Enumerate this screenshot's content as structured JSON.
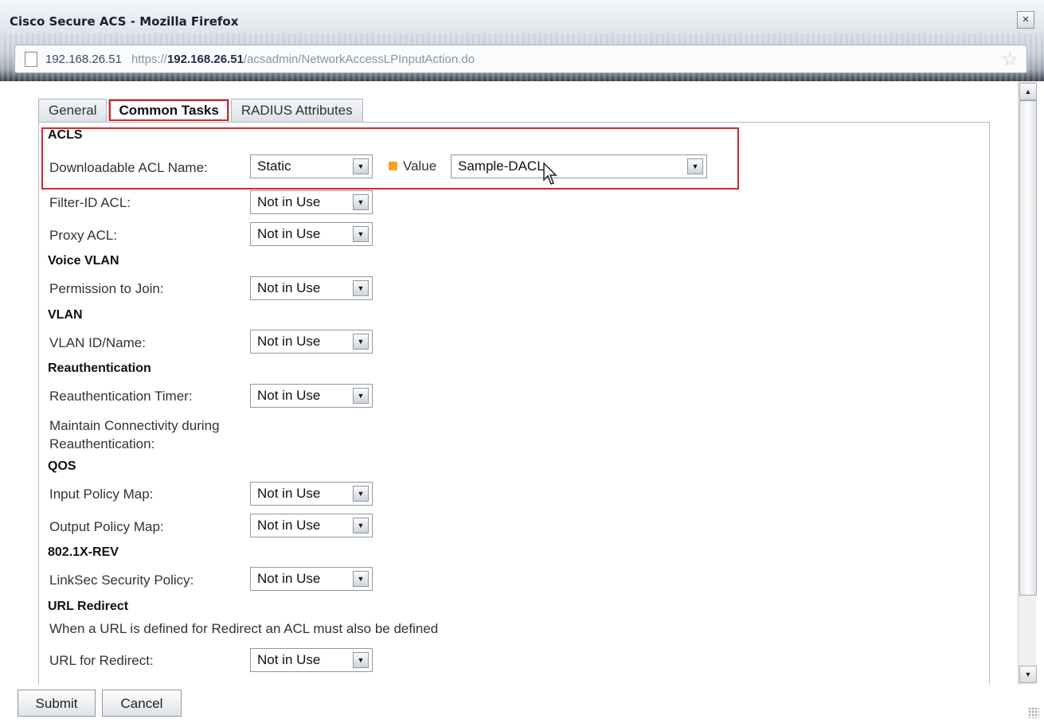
{
  "window": {
    "title": "Cisco Secure ACS - Mozilla Firefox",
    "close_label": "×"
  },
  "address": {
    "host": "192.168.26.51",
    "url_prefix": "https://",
    "url_host": "192.168.26.51",
    "url_path": "/acsadmin/NetworkAccessLPInputAction.do"
  },
  "tabs": [
    {
      "label": "General",
      "active": false
    },
    {
      "label": "Common Tasks",
      "active": true
    },
    {
      "label": "RADIUS Attributes",
      "active": false
    }
  ],
  "sections": {
    "acls": "ACLS",
    "voice_vlan": "Voice VLAN",
    "vlan": "VLAN",
    "reauth": "Reauthentication",
    "qos": "QOS",
    "dot1x": "802.1X-REV",
    "url_redirect": "URL Redirect"
  },
  "fields": {
    "dacl": {
      "label": "Downloadable ACL Name:",
      "value": "Static"
    },
    "dacl_value": {
      "label": "Value",
      "value": "Sample-DACL"
    },
    "filter_id": {
      "label": "Filter-ID ACL:",
      "value": "Not in Use"
    },
    "proxy_acl": {
      "label": "Proxy ACL:",
      "value": "Not in Use"
    },
    "permission_join": {
      "label": "Permission to Join:",
      "value": "Not in Use"
    },
    "vlan_id": {
      "label": "VLAN ID/Name:",
      "value": "Not in Use"
    },
    "reauth_timer": {
      "label": "Reauthentication Timer:",
      "value": "Not in Use"
    },
    "maintain_conn": {
      "label_line1": "Maintain Connectivity during",
      "label_line2": "Reauthentication:"
    },
    "input_policy": {
      "label": "Input Policy Map:",
      "value": "Not in Use"
    },
    "output_policy": {
      "label": "Output Policy Map:",
      "value": "Not in Use"
    },
    "linksec": {
      "label": "LinkSec Security Policy:",
      "value": "Not in Use"
    },
    "url_redirect_note": "When a URL is defined for Redirect an ACL must also be defined",
    "url_for_redirect": {
      "label": "URL for Redirect:",
      "value": "Not in Use"
    }
  },
  "footer": {
    "submit": "Submit",
    "cancel": "Cancel"
  },
  "colors": {
    "highlight": "#d6262b",
    "required_dot": "#f6a31b"
  }
}
